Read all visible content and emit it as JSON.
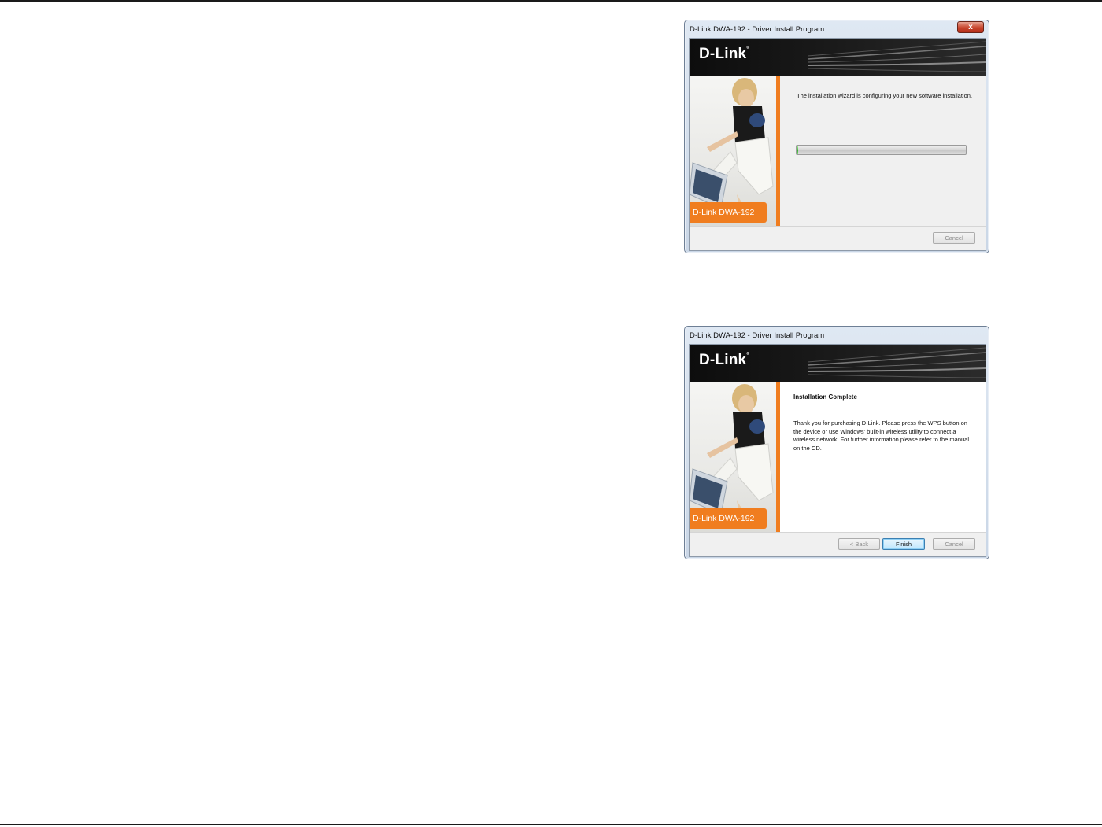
{
  "windows": [
    {
      "title": "D-Link DWA-192 - Driver Install Program",
      "close_label": "x",
      "brand": "D-Link",
      "product_label": "D-Link DWA-192",
      "message": "The installation wizard is configuring your new software installation.",
      "progress": 0.01,
      "buttons": {
        "cancel": "Cancel"
      }
    },
    {
      "title": "D-Link DWA-192 - Driver Install Program",
      "brand": "D-Link",
      "product_label": "D-Link DWA-192",
      "heading": "Installation Complete",
      "message": "Thank you for purchasing D-Link. Please press the WPS button on the device or use Windows' built-in wireless utility to connect a wireless network. For further information please refer to the manual on the CD.",
      "buttons": {
        "back": "< Back",
        "finish": "Finish",
        "cancel": "Cancel"
      }
    }
  ],
  "colors": {
    "accent_orange": "#f07d1f",
    "progress_green": "#3fbf35",
    "banner_black": "#111111"
  }
}
